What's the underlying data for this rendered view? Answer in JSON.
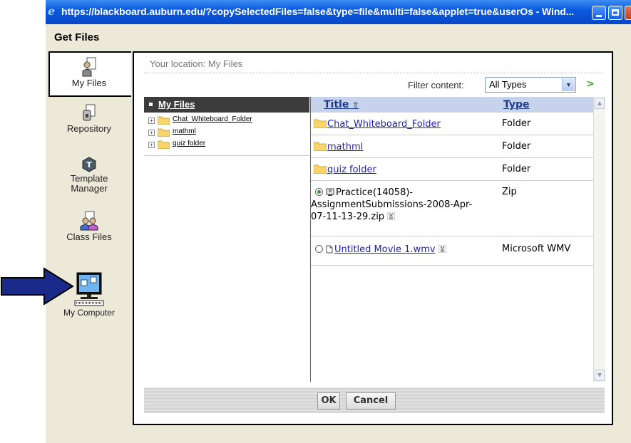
{
  "window": {
    "title": "https://blackboard.auburn.edu/?copySelectedFiles=false&type=file&multi=false&applet=true&userOs - Wind...",
    "heading": "Get Files"
  },
  "nav": [
    {
      "label": "My Files",
      "icon": "my-files-icon",
      "active": true
    },
    {
      "label": "Repository",
      "icon": "repository-icon"
    },
    {
      "label_lines": [
        "Template",
        "Manager"
      ],
      "icon": "template-manager-icon"
    },
    {
      "label": "Class Files",
      "icon": "class-files-icon"
    },
    {
      "label": "My Computer",
      "icon": "my-computer-icon"
    }
  ],
  "location": "Your location: My Files",
  "filter": {
    "label": "Filter content:",
    "value": "All Types"
  },
  "tree": {
    "root": "My Files",
    "items": [
      "Chat_Whiteboard_Folder",
      "mathml",
      "quiz folder"
    ]
  },
  "list": {
    "columns": {
      "title": "Title",
      "type": "Type"
    },
    "rows": [
      {
        "title": "Chat_Whiteboard_Folder",
        "type": "Folder",
        "kind": "folder"
      },
      {
        "title": "mathml",
        "type": "Folder",
        "kind": "folder"
      },
      {
        "title": "quiz folder",
        "type": "Folder",
        "kind": "folder"
      },
      {
        "title_lines": [
          "Practice(14058)-",
          "AssignmentSubmissions-2008-Apr-",
          "07-11-13-29.zip"
        ],
        "type": "Zip",
        "kind": "zip",
        "selected": true
      },
      {
        "title": "Untitled Movie 1.wmv",
        "type": "Microsoft WMV",
        "kind": "file",
        "selected": false
      }
    ]
  },
  "buttons": {
    "ok": "OK",
    "cancel": "Cancel"
  },
  "colors": {
    "titlebar": "#0a5be0",
    "accent": "#1f3a8f",
    "arrow": "#1a2a8a"
  }
}
